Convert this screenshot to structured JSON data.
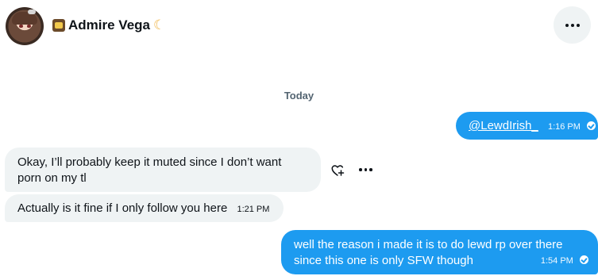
{
  "header": {
    "display_name": "Admire Vega",
    "more_label": "More"
  },
  "conversation": {
    "day_label": "Today",
    "messages": [
      {
        "side": "out",
        "mention": "@LewdIrish_",
        "time": "1:16 PM"
      },
      {
        "side": "in",
        "text": "Okay, I’ll probably keep it muted since I don’t want porn on my tl"
      },
      {
        "side": "in",
        "text": "Actually is it fine if I only follow you here",
        "time": "1:21 PM"
      },
      {
        "side": "out",
        "text": "well the reason i made it is to do lewd rp over there since this one is only SFW though",
        "time": "1:54 PM"
      }
    ]
  },
  "colors": {
    "accent": "#1d9bf0",
    "incoming_bubble": "#eff3f4",
    "muted_text": "#536471"
  },
  "icons": {
    "header_more": "more-horizontal-icon",
    "message_react": "heart-plus-icon",
    "message_more": "more-horizontal-icon",
    "sent_status": "check-circle-icon"
  }
}
